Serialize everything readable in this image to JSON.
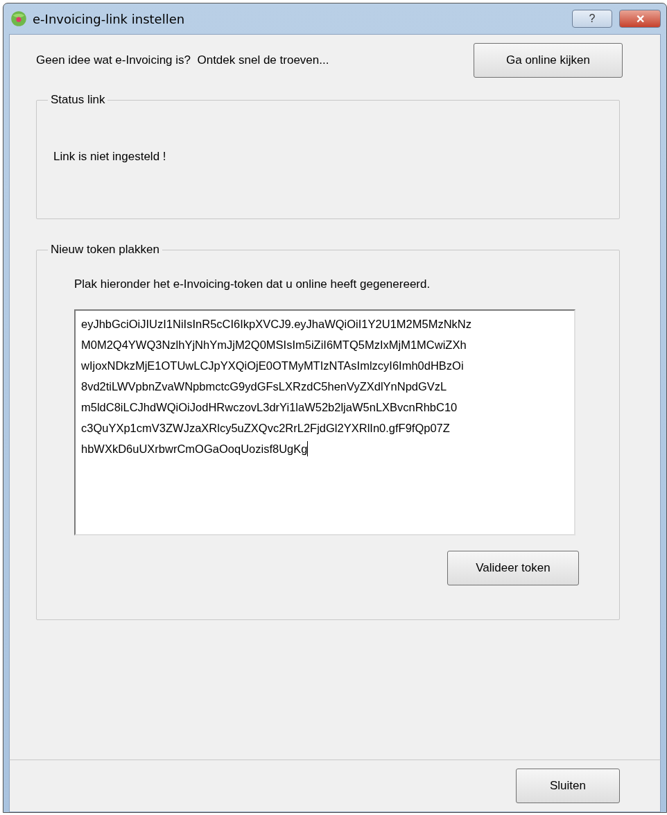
{
  "window": {
    "title": "e-Invoicing-link instellen",
    "buttons": [
      "?",
      "✕"
    ]
  },
  "intro": {
    "text": "Geen idee wat e-Invoicing is?  Ontdek snel de troeven...",
    "button": "Ga online kijken"
  },
  "status_group": {
    "legend": "Status link",
    "message": "Link is niet ingesteld !"
  },
  "token_group": {
    "legend": "Nieuw token plakken",
    "instruction": "Plak hieronder het e-Invoicing-token dat u online heeft gegenereerd.",
    "token_lines": [
      "eyJhbGciOiJIUzI1NiIsInR5cCI6IkpXVCJ9.eyJhaWQiOiI1Y2U1M2M5MzNkNz",
      "M0M2Q4YWQ3NzlhYjNhYmJjM2Q0MSIsIm5iZiI6MTQ5MzIxMjM1MCwiZXh",
      "wIjoxNDkzMjE1OTUwLCJpYXQiOjE0OTMyMTIzNTAsImlzcyI6Imh0dHBzOi",
      "8vd2tiLWVpbnZvaWNpbmctcG9ydGFsLXRzdC5henVyZXdlYnNpdGVzL",
      "m5ldC8iLCJhdWQiOiJodHRwczovL3drYi1laW52b2ljaW5nLXBvcnRhbC10",
      "c3QuYXp1cmV3ZWJzaXRlcy5uZXQvc2RrL2FjdGl2YXRlIn0.gfF9fQp07Z",
      "hbWXkD6uUXrbwrCmOGaOoqUozisf8UgKg"
    ],
    "button": "Valideer token"
  },
  "footer": {
    "button": "Sluiten"
  }
}
